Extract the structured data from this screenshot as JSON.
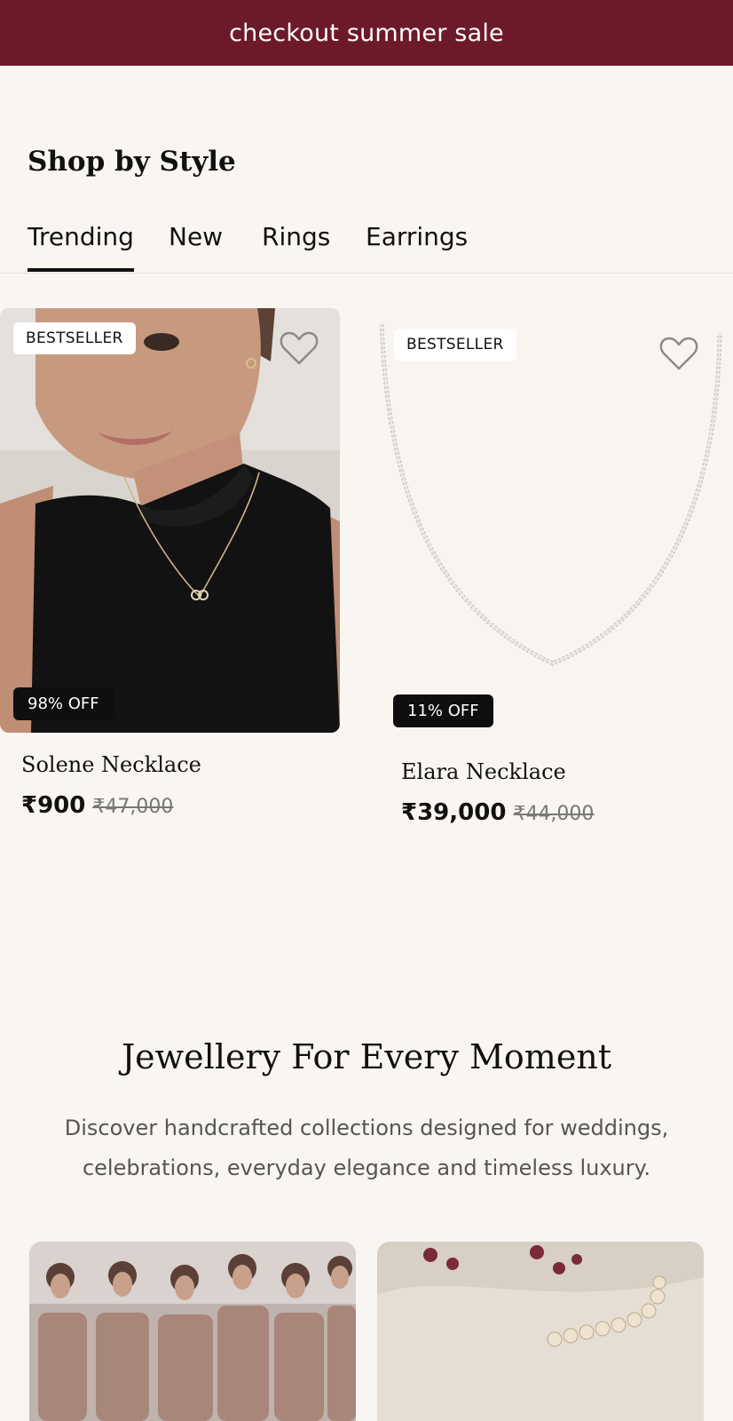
{
  "banner": {
    "text": "checkout summer sale"
  },
  "section": {
    "title": "Shop by Style"
  },
  "tabs": [
    {
      "label": "Trending",
      "active": true
    },
    {
      "label": "New",
      "active": false
    },
    {
      "label": "Rings",
      "active": false
    },
    {
      "label": "Earrings",
      "active": false
    }
  ],
  "products": [
    {
      "badge": "BESTSELLER",
      "discount": "98% OFF",
      "name": "Solene Necklace",
      "price": "₹900",
      "old_price": "₹47,000"
    },
    {
      "badge": "BESTSELLER",
      "discount": "11% OFF",
      "name": "Elara Necklace",
      "price": "₹39,000",
      "old_price": "₹44,000"
    }
  ],
  "promo": {
    "headline": "Jewellery For Every Moment",
    "description": "Discover handcrafted collections designed for weddings, celebrations, everyday elegance and timeless luxury."
  },
  "icons": {
    "wishlist": "heart-outline-icon"
  },
  "colors": {
    "banner_bg": "#6c1a2a",
    "page_bg": "#f9f6f2"
  }
}
